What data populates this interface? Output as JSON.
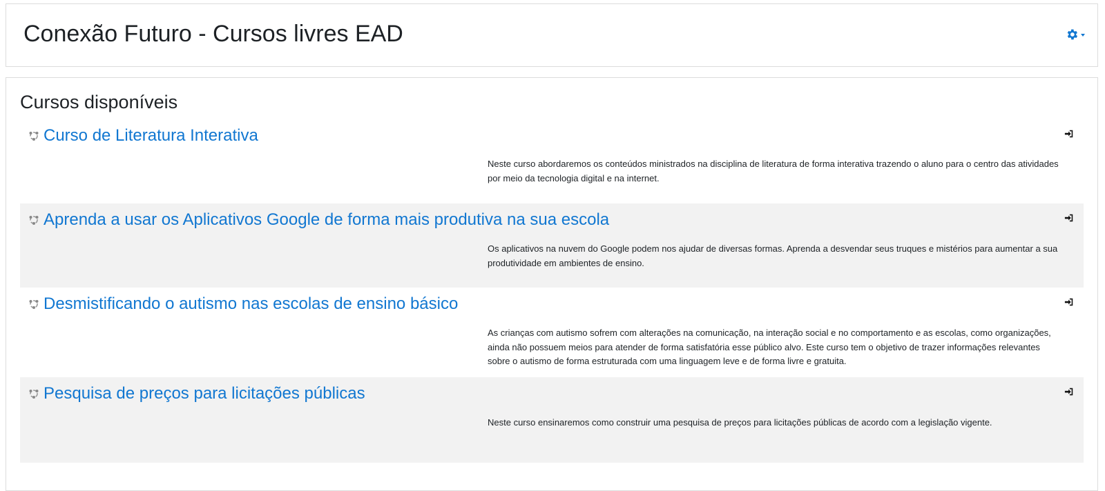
{
  "header": {
    "site_title": "Conexão Futuro - Cursos livres EAD",
    "settings_icon": "gear-icon",
    "accent_color": "#1177d1"
  },
  "main": {
    "section_title": "Cursos disponíveis",
    "courses": [
      {
        "name": "Curso de Literatura Interativa",
        "summary": "Neste curso abordaremos os conteúdos ministrados na disciplina de literatura de forma interativa trazendo o aluno para o centro das atividades por meio da tecnologia digital e na internet.",
        "icon": "course-icon",
        "enrol_icon": "sign-in-icon"
      },
      {
        "name": "Aprenda a usar os Aplicativos Google de forma mais produtiva na sua escola",
        "summary": "Os aplicativos na nuvem do Google podem nos ajudar de diversas formas. Aprenda a desvendar seus truques e mistérios para aumentar a sua produtividade em ambientes de ensino.",
        "icon": "course-icon",
        "enrol_icon": "sign-in-icon"
      },
      {
        "name": "Desmistificando o autismo nas escolas de ensino básico",
        "summary": "As crianças com autismo sofrem com alterações na comunicação, na interação social e no comportamento e as escolas, como organizações, ainda não possuem meios para atender de forma satisfatória esse público alvo. Este curso tem o objetivo de trazer informações relevantes sobre o autismo de forma estruturada com uma linguagem leve e de forma livre e gratuita.",
        "icon": "course-icon",
        "enrol_icon": "sign-in-icon"
      },
      {
        "name": "Pesquisa de preços para licitações públicas",
        "summary": "Neste curso ensinaremos como construir uma pesquisa de preços para licitações públicas de acordo com a legislação vigente.",
        "icon": "course-icon",
        "enrol_icon": "sign-in-icon"
      }
    ]
  }
}
